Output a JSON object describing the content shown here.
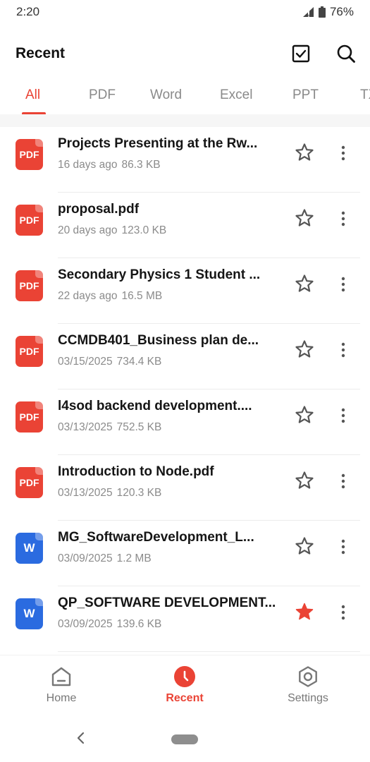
{
  "status_bar": {
    "time": "2:20",
    "battery": "76%"
  },
  "header": {
    "title": "Recent",
    "select_icon": "checkbox-icon",
    "search_icon": "search-icon"
  },
  "tabs": [
    {
      "label": "All",
      "active": true
    },
    {
      "label": "PDF"
    },
    {
      "label": "Word"
    },
    {
      "label": "Excel"
    },
    {
      "label": "PPT"
    },
    {
      "label": "TXT"
    }
  ],
  "files": [
    {
      "name": "Projects Presenting at the Rw...",
      "date": "16 days ago",
      "size": "86.3 KB",
      "type": "pdf",
      "icon_label": "PDF",
      "starred": false
    },
    {
      "name": "proposal.pdf",
      "date": "20 days ago",
      "size": "123.0 KB",
      "type": "pdf",
      "icon_label": "PDF",
      "starred": false
    },
    {
      "name": "Secondary Physics 1 Student ...",
      "date": "22 days ago",
      "size": "16.5 MB",
      "type": "pdf",
      "icon_label": "PDF",
      "starred": false
    },
    {
      "name": "CCMDB401_Business plan de...",
      "date": "03/15/2025",
      "size": "734.4 KB",
      "type": "pdf",
      "icon_label": "PDF",
      "starred": false
    },
    {
      "name": "l4sod backend development....",
      "date": "03/13/2025",
      "size": "752.5 KB",
      "type": "pdf",
      "icon_label": "PDF",
      "starred": false
    },
    {
      "name": "Introduction to Node.pdf",
      "date": "03/13/2025",
      "size": "120.3 KB",
      "type": "pdf",
      "icon_label": "PDF",
      "starred": false
    },
    {
      "name": "MG_SoftwareDevelopment_L...",
      "date": "03/09/2025",
      "size": "1.2 MB",
      "type": "word",
      "icon_label": "W",
      "starred": false
    },
    {
      "name": "QP_SOFTWARE DEVELOPMENT...",
      "date": "03/09/2025",
      "size": "139.6 KB",
      "type": "word",
      "icon_label": "W",
      "starred": true
    }
  ],
  "bottom_nav": [
    {
      "label": "Home",
      "icon": "home-icon",
      "active": false
    },
    {
      "label": "Recent",
      "icon": "clock-icon",
      "active": true
    },
    {
      "label": "Settings",
      "icon": "settings-icon",
      "active": false
    }
  ],
  "colors": {
    "accent": "#ea4335",
    "pdf": "#ea4335",
    "word": "#2b6be0",
    "muted": "#8b8b8b"
  }
}
